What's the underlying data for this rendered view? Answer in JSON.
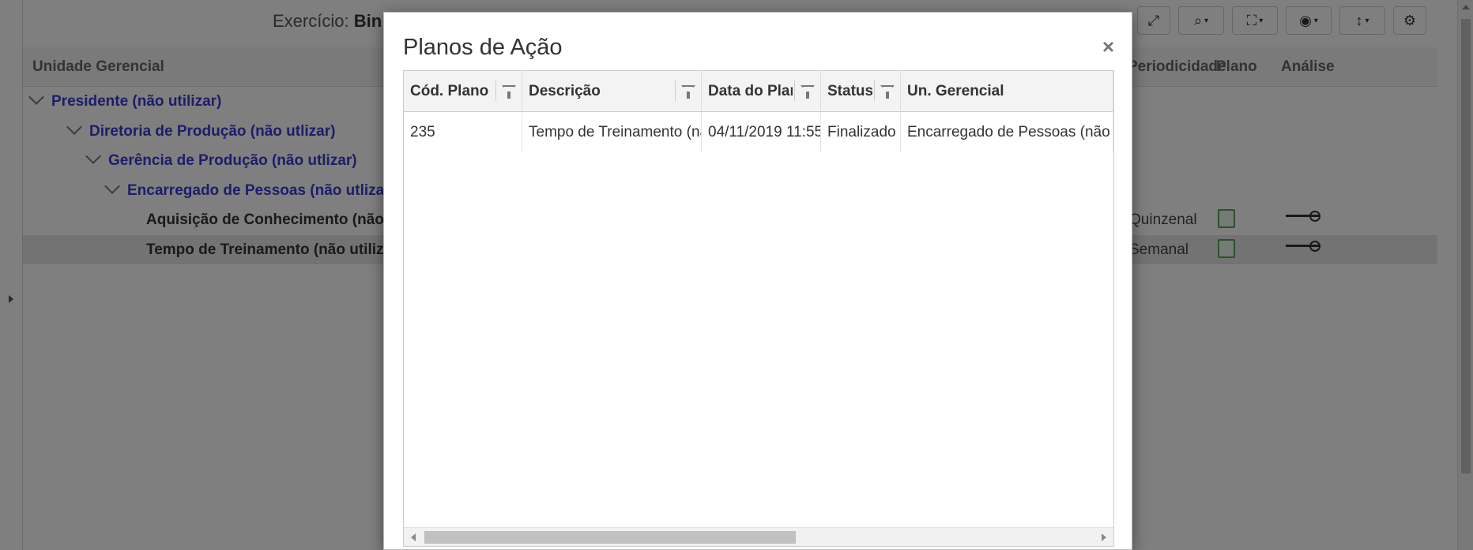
{
  "background": {
    "exercicio_label": "Exercício:",
    "exercicio_value": "Bin",
    "toolbar": [
      {
        "icon": "expand-icon",
        "glyph": "⤢",
        "caret": false
      },
      {
        "icon": "search-icon",
        "glyph": "⌕",
        "caret": true
      },
      {
        "icon": "hierarchy-icon",
        "glyph": "⛶",
        "caret": true
      },
      {
        "icon": "eye-icon",
        "glyph": "◉",
        "caret": true
      },
      {
        "icon": "row-height-icon",
        "glyph": "↕",
        "caret": true
      },
      {
        "icon": "gear-icon",
        "glyph": "⚙",
        "caret": false
      }
    ],
    "columns": {
      "unidade": "Unidade Gerencial",
      "periodicidade": "Periodicidade",
      "plano": "Plano",
      "analise": "Análise"
    },
    "tree": [
      {
        "label": "Presidente (não utilizar)",
        "type": "node",
        "level": 0,
        "periodicidade": ""
      },
      {
        "label": "Diretoria de Produção (não utlizar)",
        "type": "node",
        "level": 1,
        "periodicidade": ""
      },
      {
        "label": "Gerência de Produção (não utlizar)",
        "type": "node",
        "level": 2,
        "periodicidade": ""
      },
      {
        "label": "Encarregado de Pessoas (não utlizar)",
        "type": "node",
        "level": 3,
        "periodicidade": ""
      },
      {
        "label": "Aquisição de Conhecimento (não utilizar)",
        "type": "leaf",
        "level": 4,
        "periodicidade": "Quinzenal"
      },
      {
        "label": "Tempo de Treinamento (não utilizar)",
        "type": "leaf",
        "level": 4,
        "periodicidade": "Semanal",
        "selected": true
      }
    ]
  },
  "modal": {
    "title": "Planos de Ação",
    "close_label": "×",
    "headers": [
      "Cód. Plano",
      "Descrição",
      "Data do Plano",
      "Status",
      "Un. Gerencial"
    ],
    "rows": [
      [
        "235",
        "Tempo de Treinamento (não utilizar)",
        "04/11/2019 11:55",
        "Finalizado com sucesso",
        "Encarregado de Pessoas (não utlizar)"
      ]
    ]
  },
  "colors": {
    "link_blue": "#3a3ad6",
    "plan_green": "#5aa35a",
    "backdrop": "rgba(0,0,0,0.5)"
  }
}
